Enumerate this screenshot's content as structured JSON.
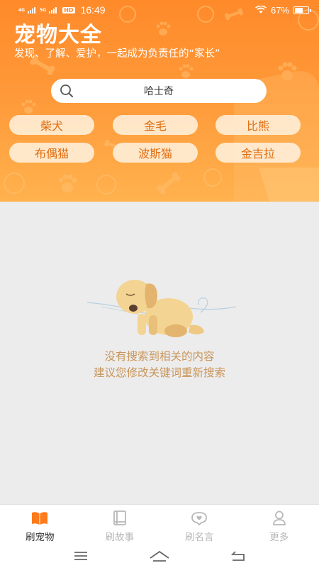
{
  "status_bar": {
    "network_1": "4G",
    "network_2": "5G",
    "hd_badge": "HD",
    "time": "16:49",
    "battery_text": "67%",
    "battery_level": 0.67
  },
  "header": {
    "title": "宠物大全",
    "subtitle": "发现、了解、爱护，一起成为负责任的“家长”"
  },
  "search": {
    "value": "哈士奇"
  },
  "tags": [
    "柴犬",
    "金毛",
    "比熊",
    "布偶猫",
    "波斯猫",
    "金吉拉"
  ],
  "empty_state": {
    "line1": "没有搜索到相关的内容",
    "line2": "建议您修改关键词重新搜索"
  },
  "bottom_nav": {
    "items": [
      {
        "label": "刷宠物",
        "icon": "open-book-icon",
        "active": true
      },
      {
        "label": "刷故事",
        "icon": "book-icon",
        "active": false
      },
      {
        "label": "刷名言",
        "icon": "heart-bubble-icon",
        "active": false
      },
      {
        "label": "更多",
        "icon": "person-icon",
        "active": false
      }
    ]
  },
  "colors": {
    "accent": "#ff8a2a",
    "tag_text": "#e06d10",
    "empty_text": "#c9955a",
    "active_icon": "#ff7a1a",
    "inactive": "#b8b8b8"
  }
}
